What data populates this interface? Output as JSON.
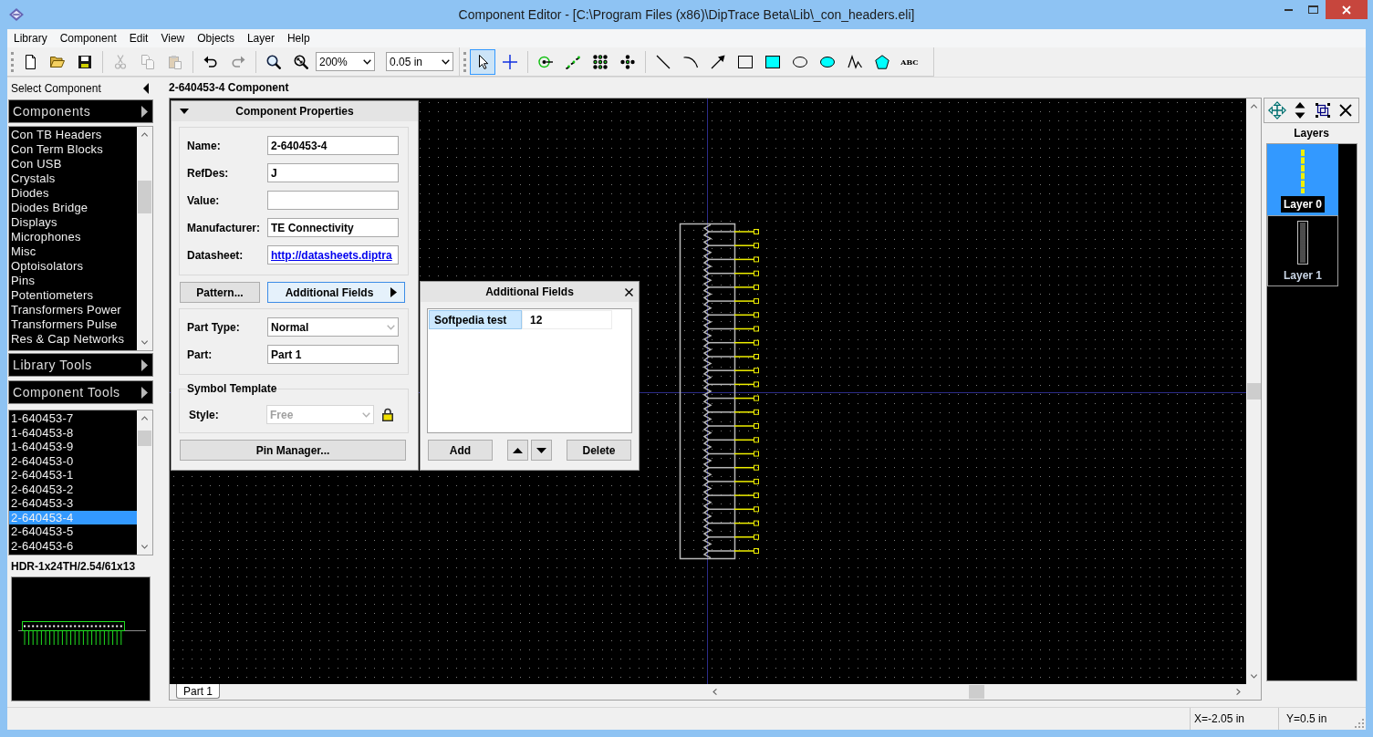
{
  "window": {
    "title": "Component Editor - [C:\\Program Files (x86)\\DipTrace Beta\\Lib\\_con_headers.eli]"
  },
  "menu": [
    "Library",
    "Component",
    "Edit",
    "View",
    "Objects",
    "Layer",
    "Help"
  ],
  "toolbar": {
    "bands": [
      {
        "groups": [
          {
            "items": [
              {
                "kind": "new",
                "disabled": false
              },
              {
                "kind": "open",
                "disabled": false
              },
              {
                "kind": "save",
                "disabled": false
              }
            ]
          },
          {
            "items": [
              {
                "kind": "cut",
                "disabled": true
              },
              {
                "kind": "copy",
                "disabled": true
              },
              {
                "kind": "paste",
                "disabled": true
              }
            ]
          },
          {
            "items": [
              {
                "kind": "undo",
                "disabled": false
              },
              {
                "kind": "redo",
                "disabled": true
              }
            ]
          },
          {
            "items": [
              {
                "kind": "zoom-in",
                "disabled": false
              },
              {
                "kind": "zoom-extents",
                "disabled": false
              },
              {
                "kind": "dropdown",
                "value": "200%",
                "disabled": false
              },
              {
                "kind": "dropdown",
                "value": "0.05 in",
                "disabled": false
              }
            ]
          }
        ]
      },
      {
        "groups": [
          {
            "items": [
              {
                "kind": "select",
                "selected": true
              },
              {
                "kind": "cross",
                "selected": false
              }
            ]
          },
          {
            "items": [
              {
                "kind": "pin",
                "selected": false
              },
              {
                "kind": "pin-row",
                "selected": false
              },
              {
                "kind": "pin-grid",
                "selected": false
              },
              {
                "kind": "pin-cross",
                "selected": false
              }
            ]
          },
          {
            "items": [
              {
                "kind": "line",
                "selected": false
              },
              {
                "kind": "arc",
                "selected": false
              },
              {
                "kind": "arrow",
                "selected": false
              },
              {
                "kind": "rectangle",
                "selected": false
              },
              {
                "kind": "filled-rectangle",
                "selected": false
              },
              {
                "kind": "ellipse",
                "selected": false
              },
              {
                "kind": "filled-ellipse",
                "selected": false
              },
              {
                "kind": "polyline",
                "selected": false
              },
              {
                "kind": "polygon",
                "selected": false
              },
              {
                "kind": "text",
                "label": "ABC",
                "selected": false
              }
            ]
          }
        ]
      }
    ]
  },
  "select_component": {
    "title": "Select Component",
    "libraries_header": "Components",
    "libraries": [
      {
        "label": "Con TB Headers",
        "selected": false
      },
      {
        "label": "Con Term Blocks",
        "selected": false
      },
      {
        "label": "Con USB",
        "selected": false
      },
      {
        "label": "Crystals",
        "selected": false
      },
      {
        "label": "Diodes",
        "selected": false
      },
      {
        "label": "Diodes Bridge",
        "selected": false
      },
      {
        "label": "Displays",
        "selected": false
      },
      {
        "label": "Microphones",
        "selected": false
      },
      {
        "label": "Misc",
        "selected": false
      },
      {
        "label": "Optoisolators",
        "selected": false
      },
      {
        "label": "Pins",
        "selected": false
      },
      {
        "label": "Potentiometers",
        "selected": false
      },
      {
        "label": "Transformers Power",
        "selected": false
      },
      {
        "label": "Transformers Pulse",
        "selected": false
      },
      {
        "label": "Res & Cap Networks",
        "selected": false
      }
    ],
    "library_tools_header": "Library Tools",
    "component_tools_header": "Component Tools",
    "components": [
      {
        "label": "1-640453-7",
        "selected": false
      },
      {
        "label": "1-640453-8",
        "selected": false
      },
      {
        "label": "1-640453-9",
        "selected": false
      },
      {
        "label": "2-640453-0",
        "selected": false
      },
      {
        "label": "2-640453-1",
        "selected": false
      },
      {
        "label": "2-640453-2",
        "selected": false
      },
      {
        "label": "2-640453-3",
        "selected": false
      },
      {
        "label": "2-640453-4",
        "selected": true
      },
      {
        "label": "2-640453-5",
        "selected": false
      },
      {
        "label": "2-640453-6",
        "selected": false
      }
    ],
    "pattern": "HDR-1x24TH/2.54/61x13"
  },
  "document": {
    "title": "2-640453-4 Component",
    "tabs": [
      {
        "label": "Part 1",
        "selected": true
      }
    ]
  },
  "component_properties": {
    "title": "Component Properties",
    "expanded": true,
    "fields": [
      {
        "label": "Name:",
        "value": "2-640453-4",
        "kind": "text"
      },
      {
        "label": "RefDes:",
        "value": "J",
        "kind": "text"
      },
      {
        "label": "Value:",
        "kind": "text"
      },
      {
        "label": "Manufacturer:",
        "value": "TE Connectivity",
        "kind": "text"
      },
      {
        "label": "Datasheet:",
        "value": "http://datasheets.diptra",
        "kind": "link"
      }
    ],
    "buttons": [
      {
        "label": "Pattern...",
        "kind": "plain",
        "active": false
      },
      {
        "label": "Additional Fields",
        "kind": "submenu",
        "active": true
      }
    ],
    "part_fields": [
      {
        "label": "Part Type:",
        "value": "Normal",
        "kind": "dropdown"
      },
      {
        "label": "Part:",
        "value": "Part 1",
        "kind": "text"
      }
    ],
    "symbol_template": {
      "title": "Symbol Template",
      "label": "Style:",
      "value": "Free",
      "disabled": true,
      "locked": true
    },
    "pin_manager": "Pin Manager..."
  },
  "additional_fields": {
    "title": "Additional Fields",
    "rows": [
      {
        "name": "Softpedia test",
        "value": "12",
        "selected": true
      }
    ],
    "add": "Add",
    "delete": "Delete"
  },
  "layers": {
    "title": "Layers",
    "items": [
      {
        "label": "Layer 0",
        "kind": "pins",
        "selected": true
      },
      {
        "label": "Layer 1",
        "kind": "outline",
        "selected": false
      }
    ]
  },
  "status_bar": {
    "x": "X=-2.05 in",
    "y": "Y=0.5 in"
  }
}
